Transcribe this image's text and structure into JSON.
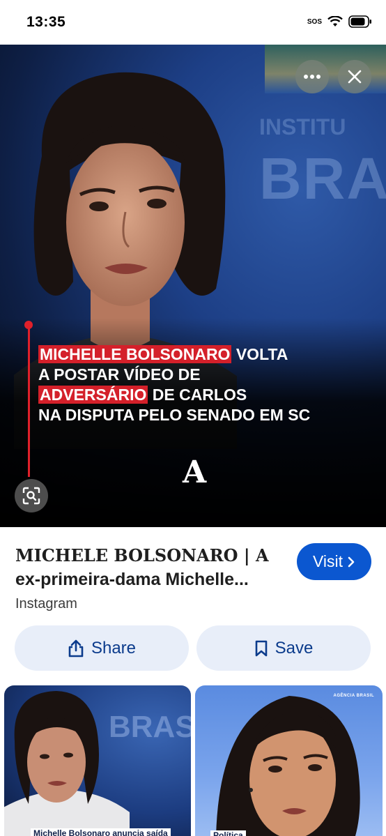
{
  "status_bar": {
    "time": "13:35",
    "sos": "SOS"
  },
  "hero": {
    "headline_lines": [
      {
        "highlight": "MICHELLE BOLSONARO",
        "rest": " VOLTA"
      },
      {
        "highlight": "",
        "rest": "A POSTAR VÍDEO DE"
      },
      {
        "highlight": "ADVERSÁRIO",
        "rest": " DE CARLOS"
      },
      {
        "highlight": "",
        "rest": "NA DISPUTA PELO SENADO EM SC"
      }
    ],
    "bg_text": "BRAS",
    "logo": "A"
  },
  "result": {
    "title_serif": "MICHELE BOLSONARO | A",
    "title_rest": "ex-primeira-dama Michelle...",
    "source": "Instagram",
    "visit_label": "Visit"
  },
  "actions": {
    "share_label": "Share",
    "save_label": "Save"
  },
  "thumbnails": [
    {
      "caption": "Michelle Bolsonaro anuncia saída",
      "bg_text": "BRAS"
    },
    {
      "caption": "Política",
      "logo": "AGÊNCIA BRASIL"
    }
  ],
  "colors": {
    "accent": "#0b57d0",
    "button_bg": "#e8eef9",
    "highlight_red": "#d4202a"
  }
}
